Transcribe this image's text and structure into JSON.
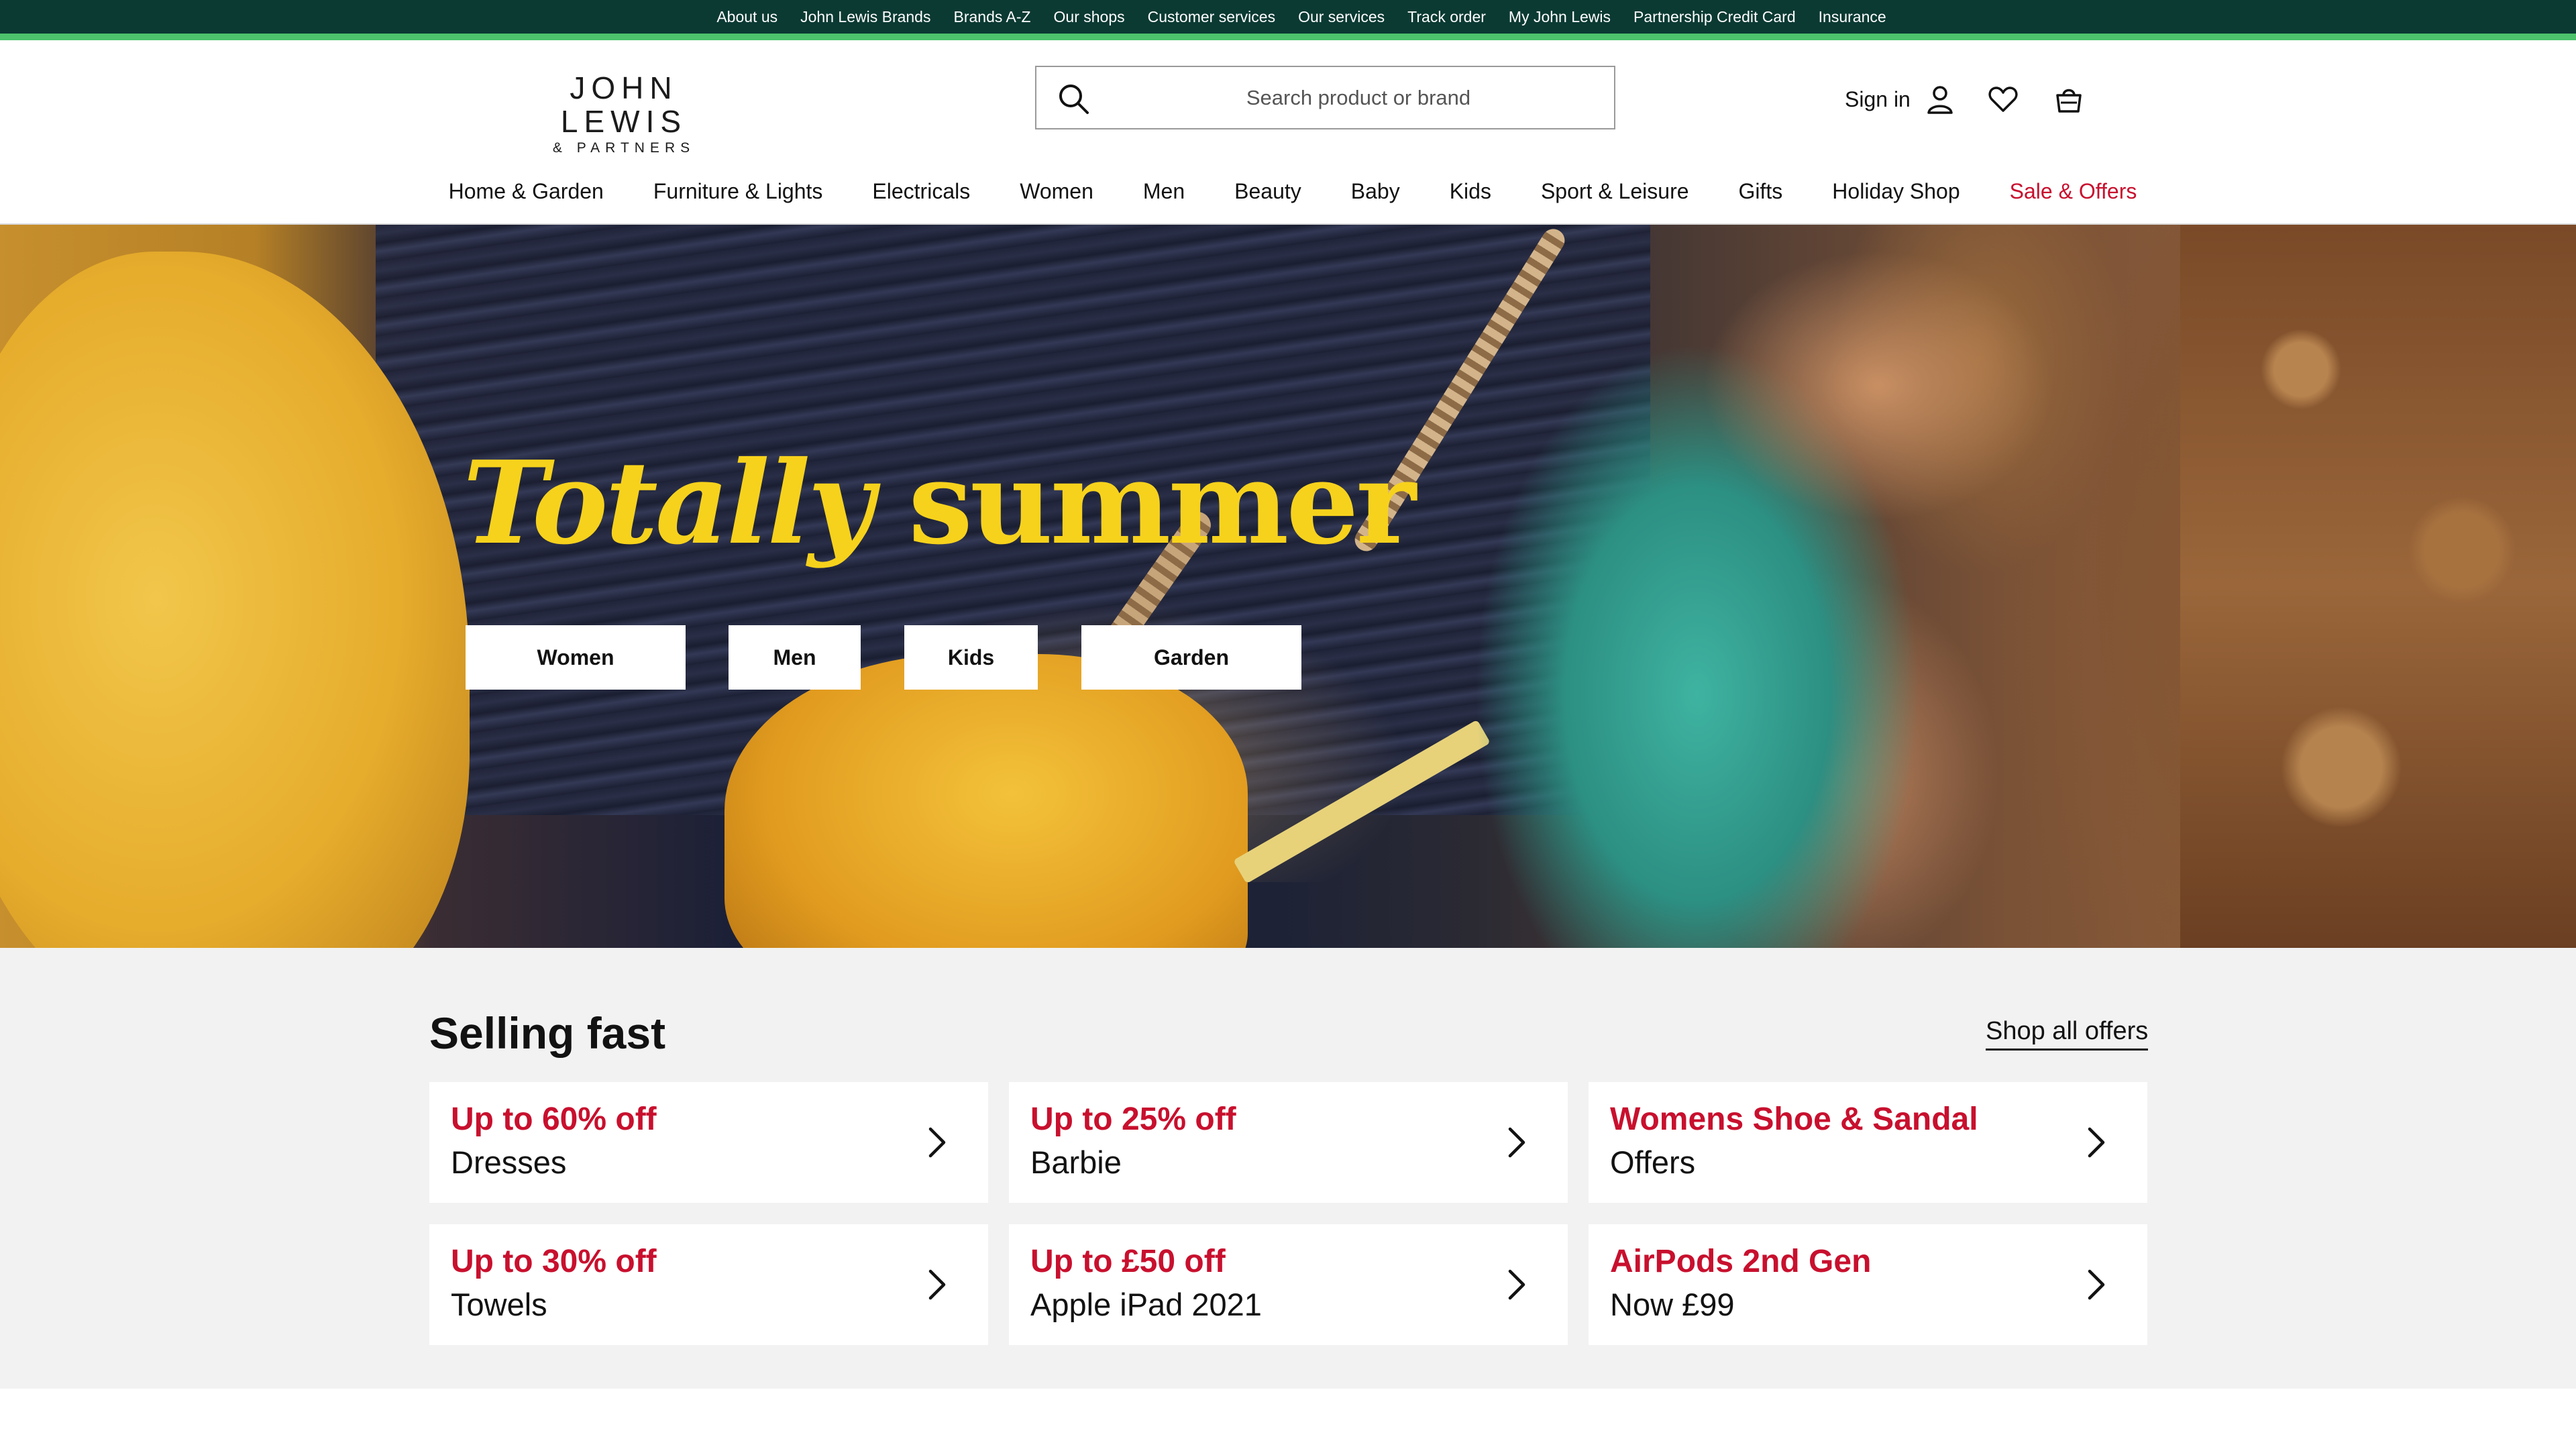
{
  "utility_links": [
    "About us",
    "John Lewis Brands",
    "Brands A-Z",
    "Our shops",
    "Customer services",
    "Our services",
    "Track order",
    "My John Lewis",
    "Partnership Credit Card",
    "Insurance"
  ],
  "logo": {
    "main": "JOHN LEWIS",
    "sub": "& PARTNERS"
  },
  "search": {
    "placeholder": "Search product or brand",
    "icon": "search-icon"
  },
  "header": {
    "sign_in_label": "Sign in",
    "icons": [
      "user-icon",
      "heart-icon",
      "basket-icon"
    ]
  },
  "nav": [
    "Home & Garden",
    "Furniture & Lights",
    "Electricals",
    "Women",
    "Men",
    "Beauty",
    "Baby",
    "Kids",
    "Sport & Leisure",
    "Gifts",
    "Holiday Shop",
    "Sale & Offers"
  ],
  "hero": {
    "title_italic": "Totally",
    "title_rest": "summer",
    "buttons": [
      "Women",
      "Men",
      "Kids",
      "Garden"
    ]
  },
  "selling_fast": {
    "title": "Selling fast",
    "shop_all": "Shop all offers",
    "cards": [
      {
        "top": "Up to 60% off",
        "bottom": "Dresses"
      },
      {
        "top": "Up to 25% off",
        "bottom": "Barbie"
      },
      {
        "top": "Womens Shoe & Sandal",
        "bottom": "Offers"
      },
      {
        "top": "Up to 30% off",
        "bottom": "Towels"
      },
      {
        "top": "Up to £50 off",
        "bottom": "Apple iPad 2021"
      },
      {
        "top": "AirPods 2nd Gen",
        "bottom": "Now £99"
      }
    ]
  },
  "colors": {
    "utility_bg": "#0b3a33",
    "accent_green": "#4cc36c",
    "sale_red": "#c8102e",
    "hero_title": "#f7d21c"
  }
}
